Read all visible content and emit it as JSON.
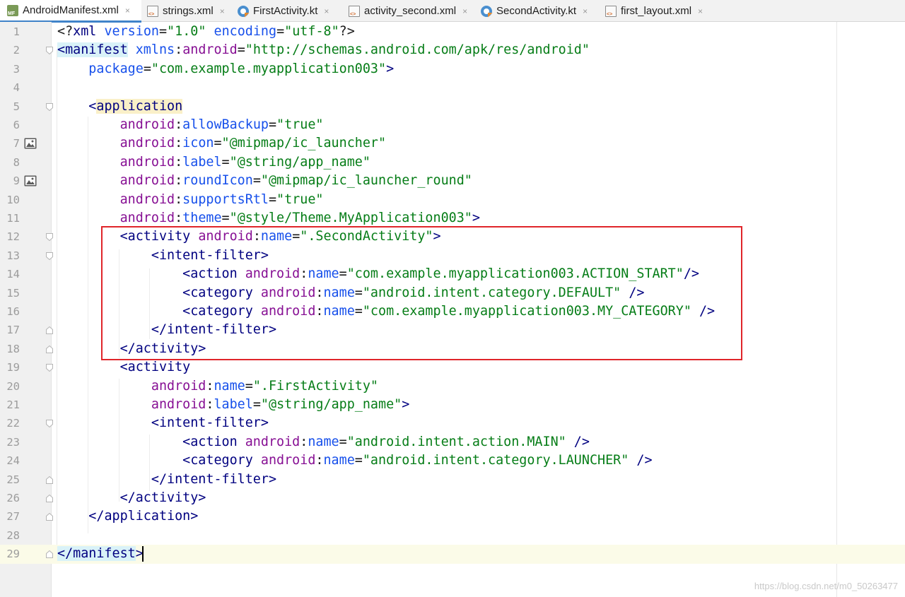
{
  "tabs": [
    {
      "label": "AndroidManifest.xml",
      "icon": "manifest-file-icon",
      "active": true
    },
    {
      "label": "strings.xml",
      "icon": "xml-file-icon",
      "active": false
    },
    {
      "label": "FirstActivity.kt",
      "icon": "kotlin-file-icon",
      "active": false
    },
    {
      "label": "activity_second.xml",
      "icon": "xml-file-icon",
      "active": false
    },
    {
      "label": "SecondActivity.kt",
      "icon": "kotlin-file-icon",
      "active": false
    },
    {
      "label": "first_layout.xml",
      "icon": "xml-file-icon",
      "active": false
    }
  ],
  "tab_close_glyph": "×",
  "editor": {
    "current_line": 29,
    "colors": {
      "tag": "#000080",
      "namespace": "#871094",
      "attribute": "#1750eb",
      "value": "#067d17",
      "highlight_box": "#e0252a",
      "tab_active_underline": "#4083c9"
    },
    "lines": [
      {
        "n": "1",
        "seg": [
          [
            "pi",
            "<?"
          ],
          [
            "tag",
            "xml "
          ],
          [
            "attr",
            "version"
          ],
          [
            "punct",
            "="
          ],
          [
            "val",
            "\"1.0\""
          ],
          [
            "punct",
            " "
          ],
          [
            "attr",
            "encoding"
          ],
          [
            "punct",
            "="
          ],
          [
            "val",
            "\"utf-8\""
          ],
          [
            "pi",
            "?>"
          ]
        ]
      },
      {
        "n": "2",
        "seg": [
          [
            "tagbg",
            "<manifest"
          ],
          [
            "punct",
            " "
          ],
          [
            "attr",
            "xmlns"
          ],
          [
            "punct",
            ":"
          ],
          [
            "ns",
            "android"
          ],
          [
            "punct",
            "="
          ],
          [
            "val",
            "\"http://schemas.android.com/apk/res/android\""
          ]
        ]
      },
      {
        "n": "3",
        "seg": [
          [
            "punct",
            "    "
          ],
          [
            "attr",
            "package"
          ],
          [
            "punct",
            "="
          ],
          [
            "val",
            "\"com.example.myapplication003\""
          ],
          [
            "tag",
            ">"
          ]
        ]
      },
      {
        "n": "4",
        "seg": []
      },
      {
        "n": "5",
        "seg": [
          [
            "punct",
            "    "
          ],
          [
            "tag",
            "<"
          ],
          [
            "tagbg2",
            "application"
          ]
        ]
      },
      {
        "n": "6",
        "seg": [
          [
            "punct",
            "        "
          ],
          [
            "ns",
            "android"
          ],
          [
            "punct",
            ":"
          ],
          [
            "attr",
            "allowBackup"
          ],
          [
            "punct",
            "="
          ],
          [
            "val",
            "\"true\""
          ]
        ]
      },
      {
        "n": "7",
        "seg": [
          [
            "punct",
            "        "
          ],
          [
            "ns",
            "android"
          ],
          [
            "punct",
            ":"
          ],
          [
            "attr",
            "icon"
          ],
          [
            "punct",
            "="
          ],
          [
            "val",
            "\"@mipmap/ic_launcher\""
          ]
        ]
      },
      {
        "n": "8",
        "seg": [
          [
            "punct",
            "        "
          ],
          [
            "ns",
            "android"
          ],
          [
            "punct",
            ":"
          ],
          [
            "attr",
            "label"
          ],
          [
            "punct",
            "="
          ],
          [
            "val",
            "\"@string/app_name\""
          ]
        ]
      },
      {
        "n": "9",
        "seg": [
          [
            "punct",
            "        "
          ],
          [
            "ns",
            "android"
          ],
          [
            "punct",
            ":"
          ],
          [
            "attr",
            "roundIcon"
          ],
          [
            "punct",
            "="
          ],
          [
            "val",
            "\"@mipmap/ic_launcher_round\""
          ]
        ]
      },
      {
        "n": "10",
        "seg": [
          [
            "punct",
            "        "
          ],
          [
            "ns",
            "android"
          ],
          [
            "punct",
            ":"
          ],
          [
            "attr",
            "supportsRtl"
          ],
          [
            "punct",
            "="
          ],
          [
            "val",
            "\"true\""
          ]
        ]
      },
      {
        "n": "11",
        "seg": [
          [
            "punct",
            "        "
          ],
          [
            "ns",
            "android"
          ],
          [
            "punct",
            ":"
          ],
          [
            "attr",
            "theme"
          ],
          [
            "punct",
            "="
          ],
          [
            "val",
            "\"@style/Theme.MyApplication003\""
          ],
          [
            "tag",
            ">"
          ]
        ]
      },
      {
        "n": "12",
        "seg": [
          [
            "punct",
            "        "
          ],
          [
            "tag",
            "<activity "
          ],
          [
            "ns",
            "android"
          ],
          [
            "punct",
            ":"
          ],
          [
            "attr",
            "name"
          ],
          [
            "punct",
            "="
          ],
          [
            "val",
            "\".SecondActivity\""
          ],
          [
            "tag",
            ">"
          ]
        ]
      },
      {
        "n": "13",
        "seg": [
          [
            "punct",
            "            "
          ],
          [
            "tag",
            "<intent-filter>"
          ]
        ]
      },
      {
        "n": "14",
        "seg": [
          [
            "punct",
            "                "
          ],
          [
            "tag",
            "<action "
          ],
          [
            "ns",
            "android"
          ],
          [
            "punct",
            ":"
          ],
          [
            "attr",
            "name"
          ],
          [
            "punct",
            "="
          ],
          [
            "val",
            "\"com.example.myapplication003.ACTION_START\""
          ],
          [
            "tag",
            "/>"
          ]
        ]
      },
      {
        "n": "15",
        "seg": [
          [
            "punct",
            "                "
          ],
          [
            "tag",
            "<category "
          ],
          [
            "ns",
            "android"
          ],
          [
            "punct",
            ":"
          ],
          [
            "attr",
            "name"
          ],
          [
            "punct",
            "="
          ],
          [
            "val",
            "\"android.intent.category.DEFAULT\""
          ],
          [
            "tag",
            " />"
          ]
        ]
      },
      {
        "n": "16",
        "seg": [
          [
            "punct",
            "                "
          ],
          [
            "tag",
            "<category "
          ],
          [
            "ns",
            "android"
          ],
          [
            "punct",
            ":"
          ],
          [
            "attr",
            "name"
          ],
          [
            "punct",
            "="
          ],
          [
            "val",
            "\"com.example.myapplication003.MY_CATEGORY\""
          ],
          [
            "tag",
            " />"
          ]
        ]
      },
      {
        "n": "17",
        "seg": [
          [
            "punct",
            "            "
          ],
          [
            "tag",
            "</intent-filter>"
          ]
        ]
      },
      {
        "n": "18",
        "seg": [
          [
            "punct",
            "        "
          ],
          [
            "tag",
            "</activity>"
          ]
        ]
      },
      {
        "n": "19",
        "seg": [
          [
            "punct",
            "        "
          ],
          [
            "tag",
            "<activity"
          ]
        ]
      },
      {
        "n": "20",
        "seg": [
          [
            "punct",
            "            "
          ],
          [
            "ns",
            "android"
          ],
          [
            "punct",
            ":"
          ],
          [
            "attr",
            "name"
          ],
          [
            "punct",
            "="
          ],
          [
            "val",
            "\".FirstActivity\""
          ]
        ]
      },
      {
        "n": "21",
        "seg": [
          [
            "punct",
            "            "
          ],
          [
            "ns",
            "android"
          ],
          [
            "punct",
            ":"
          ],
          [
            "attr",
            "label"
          ],
          [
            "punct",
            "="
          ],
          [
            "val",
            "\"@string/app_name\""
          ],
          [
            "tag",
            ">"
          ]
        ]
      },
      {
        "n": "22",
        "seg": [
          [
            "punct",
            "            "
          ],
          [
            "tag",
            "<intent-filter>"
          ]
        ]
      },
      {
        "n": "23",
        "seg": [
          [
            "punct",
            "                "
          ],
          [
            "tag",
            "<action "
          ],
          [
            "ns",
            "android"
          ],
          [
            "punct",
            ":"
          ],
          [
            "attr",
            "name"
          ],
          [
            "punct",
            "="
          ],
          [
            "val",
            "\"android.intent.action.MAIN\""
          ],
          [
            "tag",
            " />"
          ]
        ]
      },
      {
        "n": "24",
        "seg": [
          [
            "punct",
            "                "
          ],
          [
            "tag",
            "<category "
          ],
          [
            "ns",
            "android"
          ],
          [
            "punct",
            ":"
          ],
          [
            "attr",
            "name"
          ],
          [
            "punct",
            "="
          ],
          [
            "val",
            "\"android.intent.category.LAUNCHER\""
          ],
          [
            "tag",
            " />"
          ]
        ]
      },
      {
        "n": "25",
        "seg": [
          [
            "punct",
            "            "
          ],
          [
            "tag",
            "</intent-filter>"
          ]
        ]
      },
      {
        "n": "26",
        "seg": [
          [
            "punct",
            "        "
          ],
          [
            "tag",
            "</activity>"
          ]
        ]
      },
      {
        "n": "27",
        "seg": [
          [
            "punct",
            "    "
          ],
          [
            "tag",
            "</application>"
          ]
        ]
      },
      {
        "n": "28",
        "seg": []
      },
      {
        "n": "29",
        "seg": [
          [
            "tagbg",
            "</manifest"
          ],
          [
            "tag",
            ">"
          ]
        ]
      }
    ],
    "fold_markers": {
      "2": "open",
      "5": "open",
      "12": "open",
      "13": "open",
      "17": "close",
      "18": "close",
      "19": "open",
      "22": "open",
      "25": "close",
      "26": "close",
      "27": "close",
      "29": "close"
    },
    "gutter_icons": {
      "7": "image-resource-icon",
      "9": "image-resource-icon"
    }
  },
  "watermark": "https://blog.csdn.net/m0_50263477"
}
